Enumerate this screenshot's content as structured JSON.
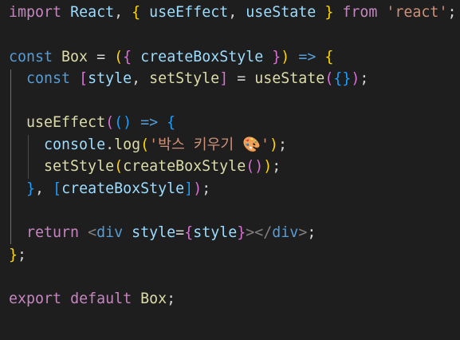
{
  "code": {
    "l1": {
      "kw_import": "import",
      "react": "React",
      "comma": ",",
      "brace_open": "{",
      "use_effect": "useEffect",
      "comma2": ",",
      "use_state": "useState",
      "brace_close": "}",
      "kw_from": "from",
      "module": "'react'",
      "semi": ";"
    },
    "l3": {
      "kw_const": "const",
      "name": "Box",
      "eq": "=",
      "paren_open": "(",
      "brace_open": "{",
      "param": "createBoxStyle",
      "brace_close": "}",
      "paren_close": ")",
      "arrow": "=>",
      "body_open": "{"
    },
    "l4": {
      "kw_const": "const",
      "bracket_open": "[",
      "style": "style",
      "comma": ",",
      "set_style": "setStyle",
      "bracket_close": "]",
      "eq": "=",
      "use_state": "useState",
      "paren_open": "(",
      "obj": "{}",
      "paren_close": ")",
      "semi": ";"
    },
    "l6": {
      "use_effect": "useEffect",
      "paren_open": "(",
      "inner_parens": "()",
      "arrow": "=>",
      "brace_open": "{"
    },
    "l7": {
      "console": "console",
      "dot": ".",
      "log": "log",
      "paren_open": "(",
      "message": "'박스 키우기 🎨'",
      "paren_close": ")",
      "semi": ";"
    },
    "l8": {
      "set_style": "setStyle",
      "paren_open": "(",
      "create_box_style": "createBoxStyle",
      "inner_parens": "()",
      "paren_close": ")",
      "semi": ";"
    },
    "l9": {
      "brace_close": "}",
      "comma": ",",
      "bracket_open": "[",
      "dep": "createBoxStyle",
      "bracket_close": "]",
      "paren_close": ")",
      "semi": ";"
    },
    "l11": {
      "kw_return": "return",
      "tag_open": "<",
      "tag_name": "div",
      "attr": "style",
      "eq": "=",
      "brace_open": "{",
      "value": "style",
      "brace_close": "}",
      "tag_gt": ">",
      "close_tag_open": "</",
      "close_tag_name": "div",
      "close_tag_gt": ">",
      "semi": ";"
    },
    "l12": {
      "brace_close": "}",
      "semi": ";"
    },
    "l14": {
      "kw_export": "export",
      "kw_default": "default",
      "name": "Box",
      "semi": ";"
    }
  }
}
